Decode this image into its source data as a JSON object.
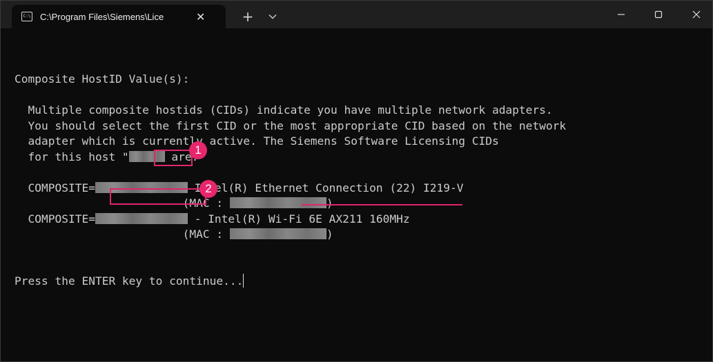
{
  "window": {
    "tab_icon_text": "C:\\",
    "tab_title": "C:\\Program Files\\Siemens\\Lice",
    "tab_close": "✕",
    "new_tab": "+"
  },
  "terminal": {
    "lines": [
      "Composite HostID Value(s):",
      "",
      "  Multiple composite hostids (CIDs) indicate you have multiple network adapters.",
      "  You should select the first CID or the most appropriate CID based on the network",
      "  adapter which is currently active. The Siemens Software Licensing CIDs",
      "  for this host \"",
      "",
      "  COMPOSITE=",
      "                         (MAC : ",
      "  COMPOSITE=",
      "                         (MAC : ",
      "",
      "",
      "Press the ENTER key to continue..."
    ],
    "host_suffix": " are:",
    "adapter1": " Intel(R) Ethernet Connection (22) I219-V",
    "adapter2": " - Intel(R) Wi-Fi 6E AX211 160MHz",
    "mac_close": ")"
  },
  "annotations": {
    "badge1": "1",
    "badge2": "2",
    "highlight_color": "#e0256c"
  }
}
